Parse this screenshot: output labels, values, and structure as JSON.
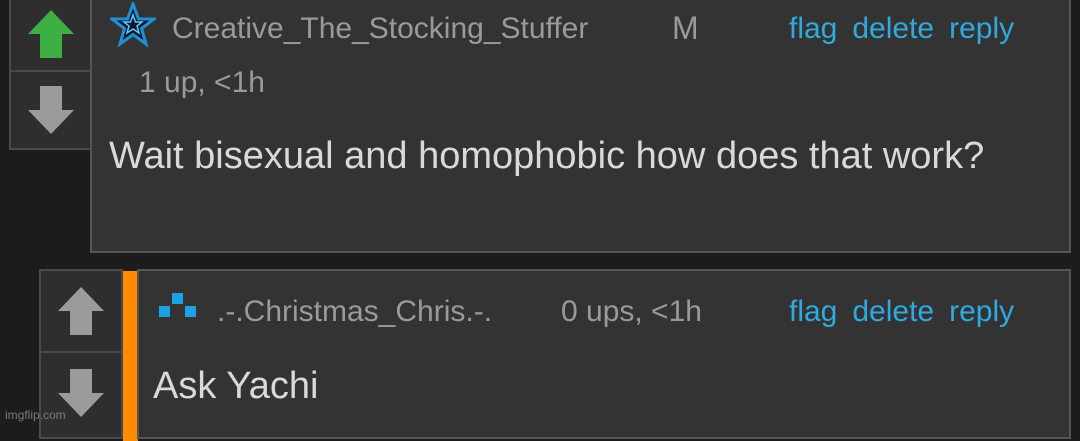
{
  "comment1": {
    "username": "Creative_The_Stocking_Stuffer",
    "gender_badge": "M",
    "score": "1 up, <1h",
    "text": "Wait bisexual and homophobic how does that work?",
    "upvoted": true,
    "actions": {
      "flag": "flag",
      "delete": "delete",
      "reply": "reply"
    }
  },
  "comment2": {
    "username": ".-.Christmas_Chris.-.",
    "score": "0 ups, <1h",
    "text": "Ask Yachi",
    "actions": {
      "flag": "flag",
      "delete": "delete",
      "reply": "reply"
    }
  },
  "watermark": "imgflip.com",
  "colors": {
    "upvote_active": "#3cb043",
    "vote_inactive": "#9b9b9b",
    "link": "#2fa9e0",
    "reply_bar": "#ff8c00",
    "user_icon_star": "#1f8fd6",
    "user_icon_blocks": "#19a3e6"
  },
  "icons": {
    "upvote": "arrow-up-icon",
    "downvote": "arrow-down-icon",
    "user1_icon": "star-icon",
    "user2_icon": "pixel-blocks-icon"
  }
}
